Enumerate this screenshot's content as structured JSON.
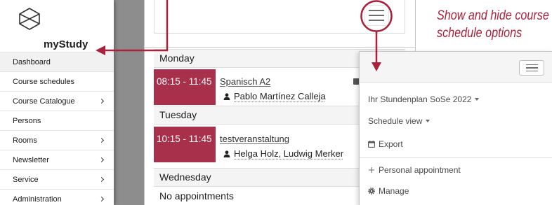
{
  "colors": {
    "event_block": "#a8304a",
    "annotation": "#a8223c",
    "backdrop": "#8d8d8d"
  },
  "sidebar": {
    "logo_icon": "mystudy-logo-icon",
    "logo_text": "myStudy",
    "items": [
      {
        "label": "Dashboard",
        "active": true,
        "has_submenu": false
      },
      {
        "label": "Course schedules",
        "active": false,
        "has_submenu": false
      },
      {
        "label": "Course Catalogue",
        "active": false,
        "has_submenu": true
      },
      {
        "label": "Persons",
        "active": false,
        "has_submenu": false
      },
      {
        "label": "Rooms",
        "active": false,
        "has_submenu": true
      },
      {
        "label": "Newsletter",
        "active": false,
        "has_submenu": true
      },
      {
        "label": "Service",
        "active": false,
        "has_submenu": true
      },
      {
        "label": "Administration",
        "active": false,
        "has_submenu": true
      }
    ]
  },
  "schedule": {
    "menu_button_icon": "hamburger-icon",
    "days": [
      {
        "name": "Monday",
        "events": [
          {
            "time": "08:15 - 11:45",
            "title": "Spanisch A2",
            "persons": "Pablo Martínez Calleja",
            "person_icon": "person-icon"
          }
        ]
      },
      {
        "name": "Tuesday",
        "events": [
          {
            "time": "10:15 - 11:45",
            "title": "testveranstaltung",
            "persons": "Helga Holz, Ludwig Merker",
            "person_icon": "person-icon"
          }
        ]
      },
      {
        "name": "Wednesday",
        "events": [],
        "empty_text": "No appointments"
      }
    ]
  },
  "options_menu": {
    "menu_button_icon": "hamburger-icon",
    "items": [
      {
        "label": "Ihr Stundenplan SoSe 2022",
        "icon": "caret-down-icon"
      },
      {
        "label": "Schedule view",
        "icon": "caret-down-icon"
      },
      {
        "label": "Export",
        "icon": "calendar-icon"
      },
      {
        "label": "Personal appointment",
        "icon": "plus-icon"
      },
      {
        "label": "Manage",
        "icon": "gear-icon"
      }
    ]
  },
  "annotation": {
    "lines": [
      "Show and hide course",
      "schedule options"
    ]
  }
}
